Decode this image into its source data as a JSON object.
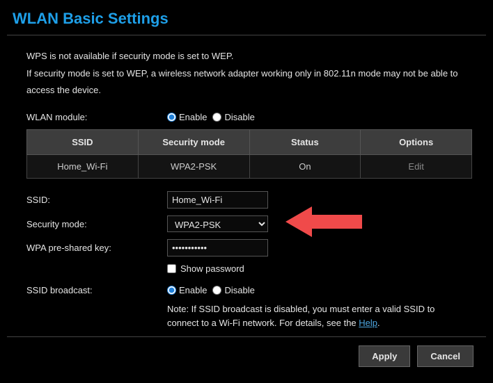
{
  "title": "WLAN Basic Settings",
  "info1": "WPS is not available if security mode is set to WEP.",
  "info2": "If security mode is set to WEP, a wireless network adapter working only in 802.11n mode may not be able to access the device.",
  "labels": {
    "wlan_module": "WLAN module:",
    "ssid": "SSID:",
    "security_mode": "Security mode:",
    "wpa_key": "WPA pre-shared key:",
    "ssid_broadcast": "SSID broadcast:",
    "enable": "Enable",
    "disable": "Disable",
    "show_password": "Show password"
  },
  "table": {
    "headers": [
      "SSID",
      "Security mode",
      "Status",
      "Options"
    ],
    "row": [
      "Home_Wi-Fi",
      "WPA2-PSK",
      "On",
      "Edit"
    ]
  },
  "fields": {
    "ssid_value": "Home_Wi-Fi",
    "security_mode_value": "WPA2-PSK",
    "wpa_key_value": "•••••••••••"
  },
  "note": {
    "prefix": "Note: If SSID broadcast is disabled, you must enter a valid SSID to connect to a Wi-Fi network. For details, see the ",
    "link": "Help",
    "suffix": "."
  },
  "buttons": {
    "apply": "Apply",
    "cancel": "Cancel"
  }
}
